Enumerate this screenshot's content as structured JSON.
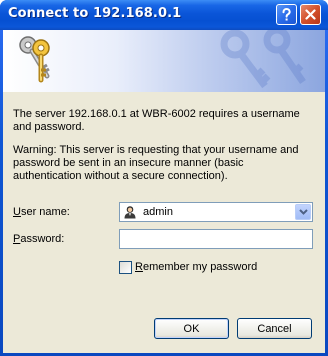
{
  "window": {
    "title": "Connect to 192.168.0.1",
    "accent_color": "#0a55d8",
    "close_color": "#d4512b"
  },
  "titlebar_buttons": {
    "help_icon": "question-mark",
    "close_icon": "x-mark"
  },
  "banner": {
    "icon": "keys-icon"
  },
  "message": {
    "line1": "The server 192.168.0.1 at WBR-6002 requires a username and password.",
    "warning": "Warning: This server is requesting that your username and password be sent in an insecure manner (basic authentication without a secure connection)."
  },
  "form": {
    "username_label_key": "U",
    "username_label_rest": "ser name:",
    "username_value": "admin",
    "username_icon": "user-icon",
    "password_label_key": "P",
    "password_label_rest": "assword:",
    "password_value": "",
    "remember_key": "R",
    "remember_rest": "emember my password",
    "remember_checked": false
  },
  "buttons": {
    "ok": "OK",
    "cancel": "Cancel"
  }
}
